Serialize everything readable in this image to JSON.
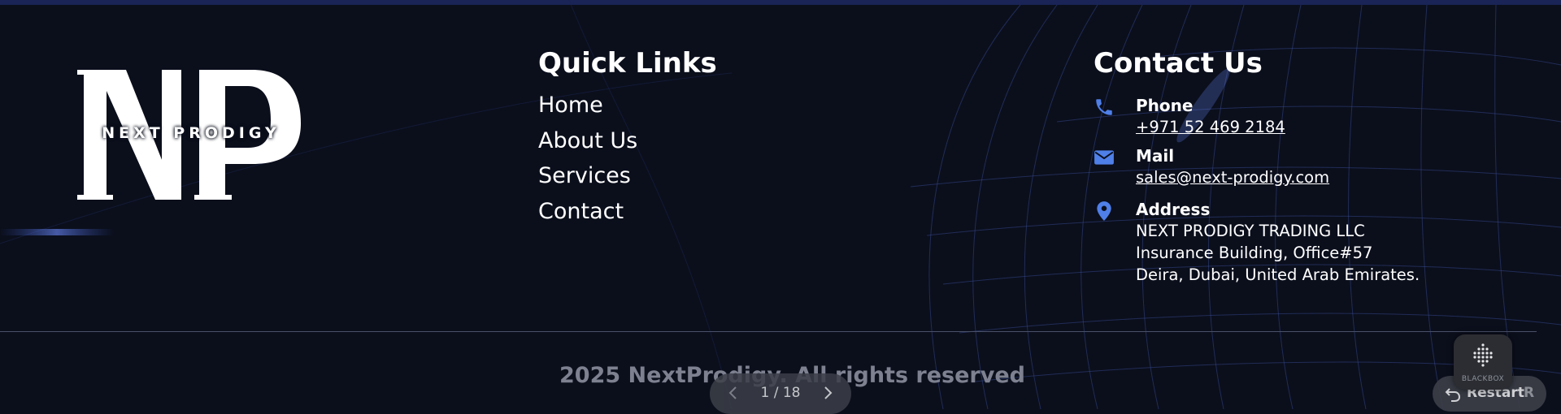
{
  "brand": {
    "logo_letters": "NP",
    "logo_text": "NEXT PRODIGY"
  },
  "quick_links": {
    "title": "Quick Links",
    "items": [
      "Home",
      "About Us",
      "Services",
      "Contact"
    ]
  },
  "contact": {
    "title": "Contact Us",
    "phone": {
      "label": "Phone",
      "value": "+971 52 469 2184",
      "icon": "phone-icon"
    },
    "mail": {
      "label": "Mail",
      "value": "sales@next-prodigy.com",
      "icon": "mail-icon"
    },
    "address": {
      "label": "Address",
      "lines": [
        "NEXT PRODIGY TRADING LLC",
        "Insurance Building, Office#57",
        "Deira, Dubai, United Arab Emirates."
      ],
      "icon": "location-pin-icon"
    }
  },
  "footer": {
    "copyright": "2025 NextProdigy. All rights reserved"
  },
  "pager": {
    "text": "1 / 18",
    "prev_icon": "chevron-left-icon",
    "next_icon": "chevron-right-icon"
  },
  "restart": {
    "label": "Restart",
    "shortcut": "R",
    "icon": "restart-icon"
  },
  "blackbox": {
    "label": "BLACKBOX"
  },
  "colors": {
    "background": "#0b0f1c",
    "top_bar": "#1a2456",
    "icon_accent": "#4f7fe8",
    "muted_text": "#7d8190"
  }
}
